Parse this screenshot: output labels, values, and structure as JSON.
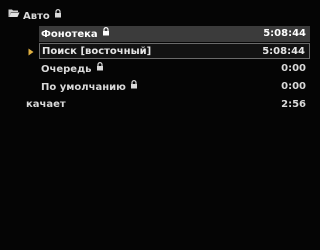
{
  "tree": {
    "root": {
      "label": "Авто",
      "icon": "folder-open-icon",
      "locked": true
    },
    "playlists": [
      {
        "label": "Фонотека",
        "duration": "5:08:44",
        "locked": true,
        "state": "selected"
      },
      {
        "label": "Поиск [восточный]",
        "duration": "5:08:44",
        "locked": false,
        "state": "focused"
      },
      {
        "label": "Очередь",
        "duration": "0:00",
        "locked": true,
        "state": "normal"
      },
      {
        "label": "По умолчанию",
        "duration": "0:00",
        "locked": true,
        "state": "normal"
      }
    ],
    "downloads": {
      "label": "качает",
      "duration": "2:56"
    }
  },
  "colors": {
    "background": "#050505",
    "text": "#d9d9d9",
    "selected_background": "#3b3b3b",
    "focus_border": "#6a6a6a"
  }
}
